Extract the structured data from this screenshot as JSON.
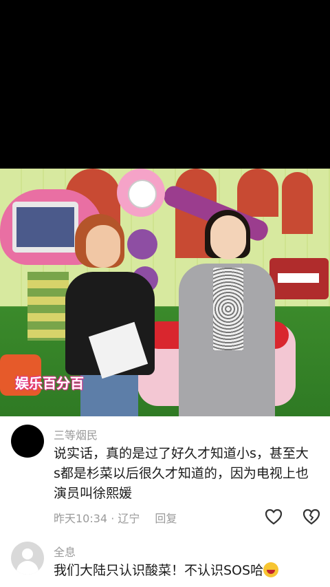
{
  "video": {
    "logo_text": "娱乐百分百"
  },
  "comments": [
    {
      "username": "三等烟民",
      "text": "说实话，真的是过了好久才知道小s，甚至大s都是杉菜以后很久才知道的，因为电视上也演员叫徐熙媛",
      "time": "昨天10:34",
      "separator": " · ",
      "location": "辽宁",
      "reply_label": "回复"
    },
    {
      "username": "全息",
      "text": "我们大陆只认识酸菜！不认识SOS哈"
    }
  ],
  "icons": {
    "like": "heart-outline-icon",
    "dislike": "broken-heart-outline-icon",
    "emoji": "laughing-emoji-icon"
  }
}
